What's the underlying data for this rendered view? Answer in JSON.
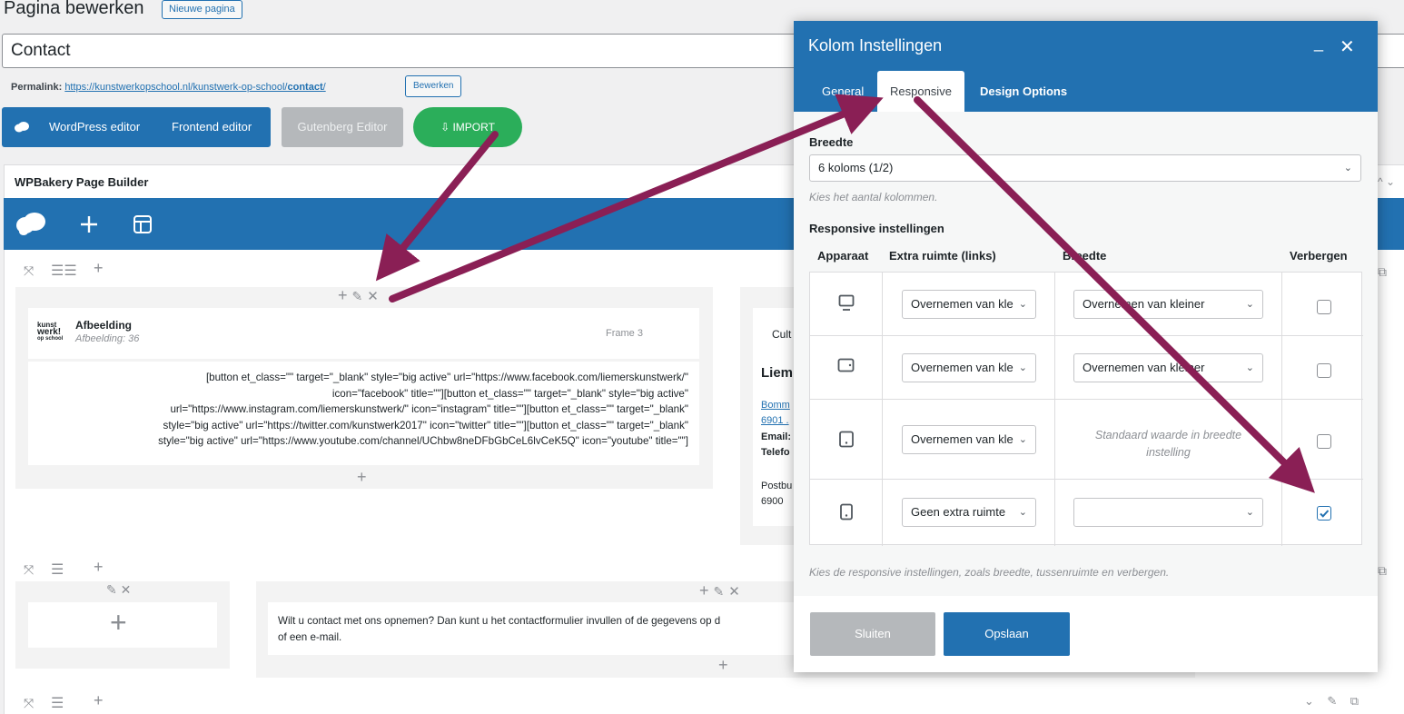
{
  "header": {
    "title": "Pagina bewerken",
    "new_page": "Nieuwe pagina",
    "post_title": "Contact",
    "permalink_label": "Permalink:",
    "permalink_base": "https://kunstwerkopschool.nl/kunstwerk-op-school/",
    "permalink_slug": "contact",
    "permalink_end": "/",
    "permalink_edit": "Bewerken"
  },
  "editor_switch": {
    "wp_editor": "WordPress editor",
    "frontend_editor": "Frontend editor",
    "gutenberg": "Gutenberg Editor",
    "import": "IMPORT"
  },
  "builder": {
    "title": "WPBakery Page Builder",
    "image_element": {
      "logo_text_1": "kunst",
      "logo_text_2": "werk!",
      "logo_text_3": "op school",
      "name": "Afbeelding",
      "sub": "Afbeelding: 36",
      "frame": "Frame 3"
    },
    "shortcode_lines": [
      "[button et_class=\"\" target=\"_blank\" style=\"big active\" url=\"https://www.facebook.com/liemerskunstwerk/\"",
      "icon=\"facebook\" title=\"\"][button et_class=\"\" target=\"_blank\" style=\"big active\"",
      "url=\"https://www.instagram.com/liemerskunstwerk/\" icon=\"instagram\" title=\"\"][button et_class=\"\" target=\"_blank\"",
      "style=\"big active\" url=\"https://twitter.com/kunstwerk2017\" icon=\"twitter\" title=\"\"][button et_class=\"\" target=\"_blank\"",
      "style=\"big active\" url=\"https://www.youtube.com/channel/UChbw8neDFbGbCeL6lvCeK5Q\" icon=\"youtube\" title=\"\"]"
    ],
    "partial_col": {
      "l1": "Cult",
      "l2": "Liem",
      "l3": "Bomm",
      "l4": "6901 .",
      "l5": "Email:",
      "l6": "Telefo",
      "l7": "Postbu",
      "l8": "6900"
    },
    "contact_text_1": "Wilt u contact met ons opnemen? Dan kunt u het contactformulier invullen of de gegevens op d",
    "contact_text_2": "of een e-mail."
  },
  "modal": {
    "title": "Kolom Instellingen",
    "tabs": [
      "General",
      "Responsive",
      "Design Options"
    ],
    "breedte_label": "Breedte",
    "breedte_value": "6 koloms (1/2)",
    "breedte_help": "Kies het aantal kolommen.",
    "responsive_label": "Responsive instellingen",
    "columns": [
      "Apparaat",
      "Extra ruimte (links)",
      "Breedte",
      "Verbergen"
    ],
    "rows": [
      {
        "device": "desktop-icon",
        "offset": "Overnemen van kle",
        "width": "Overnemen van kleiner",
        "hide": false
      },
      {
        "device": "tablet-landscape-icon",
        "offset": "Overnemen van kle",
        "width": "Overnemen van kleiner",
        "hide": false
      },
      {
        "device": "tablet-portrait-icon",
        "offset": "Overnemen van kle",
        "width_note": "Standaard waarde in breedte instelling",
        "hide": false
      },
      {
        "device": "mobile-icon",
        "offset": "Geen extra ruimte",
        "width": "",
        "hide": true
      }
    ],
    "responsive_help": "Kies de responsive instellingen, zoals breedte, tussenruimte en verbergen.",
    "close": "Sluiten",
    "save": "Opslaan"
  },
  "colors": {
    "brand_blue": "#2271b1",
    "import_green": "#2bae5a",
    "arrow": "#8a1f55"
  }
}
